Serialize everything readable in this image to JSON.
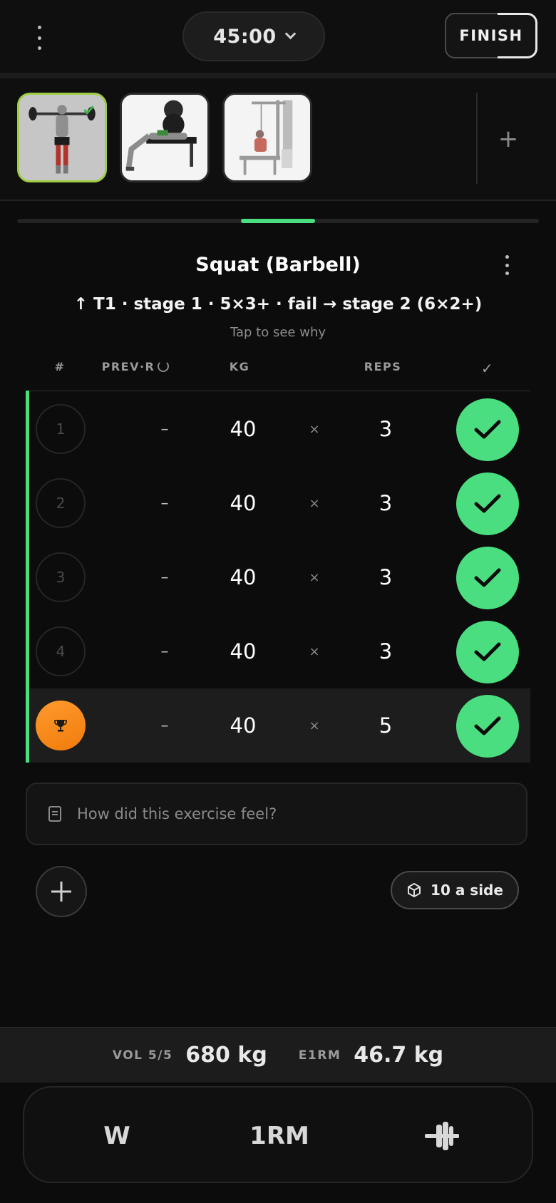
{
  "header": {
    "timer": "45:00",
    "finish_label": "FINISH"
  },
  "exercise_strip": {
    "thumbnails": [
      {
        "name": "squat-barbell-thumbnail",
        "active": true,
        "completed": true
      },
      {
        "name": "bench-press-thumbnail",
        "active": false,
        "completed": false
      },
      {
        "name": "lat-pulldown-thumbnail",
        "active": false,
        "completed": false
      }
    ],
    "add_icon": "plus-icon"
  },
  "exercise": {
    "title": "Squat (Barbell)",
    "stage_line": "↑ T1 · stage 1 · 5×3+ · fail → stage 2 (6×2+)",
    "tap_hint": "Tap to see why"
  },
  "table": {
    "headers": {
      "num": "#",
      "prev": "PREV·R",
      "kg": "KG",
      "reps": "REPS",
      "check": "✓"
    },
    "times_sign": "×",
    "rows": [
      {
        "set": "1",
        "prev": "–",
        "kg": "40",
        "reps": "3",
        "done": true,
        "pr": false
      },
      {
        "set": "2",
        "prev": "–",
        "kg": "40",
        "reps": "3",
        "done": true,
        "pr": false
      },
      {
        "set": "3",
        "prev": "–",
        "kg": "40",
        "reps": "3",
        "done": true,
        "pr": false
      },
      {
        "set": "4",
        "prev": "–",
        "kg": "40",
        "reps": "3",
        "done": true,
        "pr": false
      },
      {
        "set": "",
        "prev": "–",
        "kg": "40",
        "reps": "5",
        "done": true,
        "pr": true
      }
    ]
  },
  "note": {
    "placeholder": "How did this exercise feel?"
  },
  "plates": {
    "label": "10 a side"
  },
  "summary": {
    "vol_label": "VOL 5/5",
    "vol_value": "680 kg",
    "e1rm_label": "E1RM",
    "e1rm_value": "46.7 kg"
  },
  "bottom_bar": {
    "warmup_label": "W",
    "onerm_label": "1RM",
    "plate_icon": "dumbbell-icon"
  },
  "colors": {
    "accent_green": "#4ade80",
    "active_thumb_border": "#9fce45",
    "trophy_orange": "#f17c0c",
    "background": "#0c0c0c"
  }
}
